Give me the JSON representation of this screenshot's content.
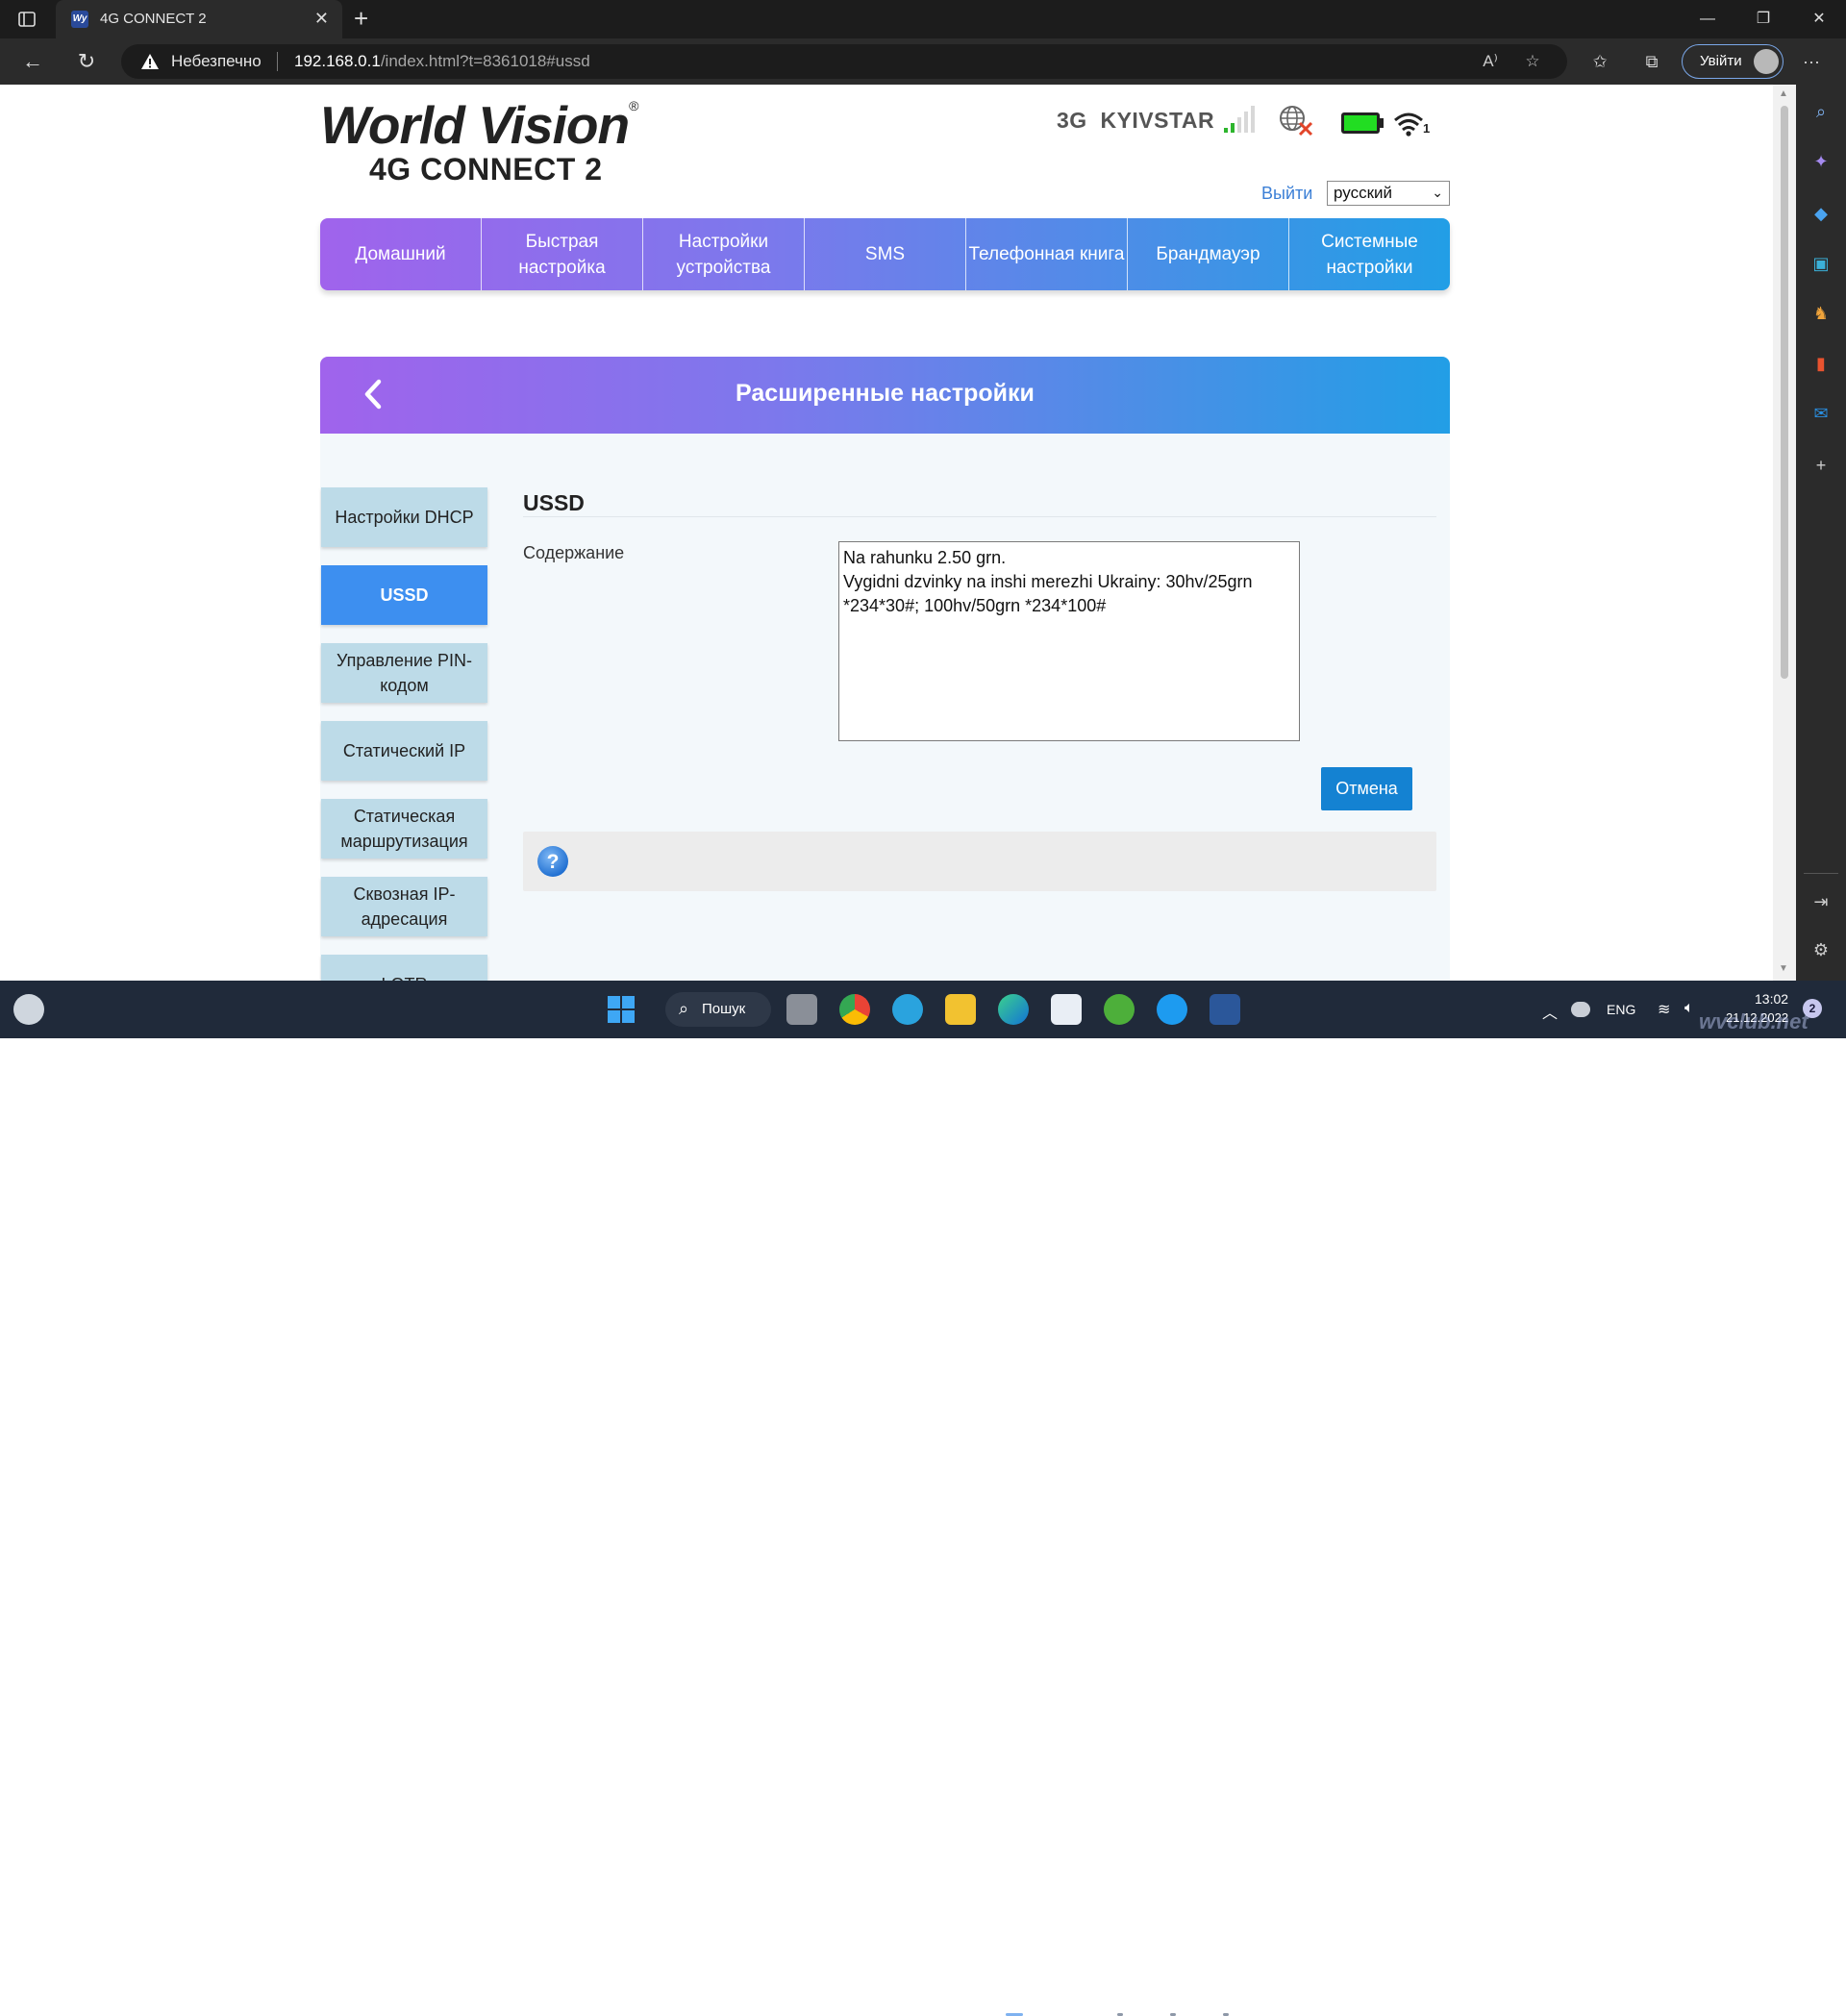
{
  "browser": {
    "tab_title": "4G CONNECT 2",
    "tab_favicon": "Wy",
    "security_label": "Небезпечно",
    "url_host": "192.168.0.1",
    "url_path": "/index.html?t=8361018#ussd",
    "signin_label": "Увійти"
  },
  "header": {
    "logo_brand": "World Vision",
    "logo_registered": "®",
    "logo_model": "4G CONNECT 2",
    "network_type": "3G",
    "operator": "KYIVSTAR",
    "wifi_clients": "1",
    "logout_label": "Выйти",
    "language_selected": "русский"
  },
  "main_nav": [
    {
      "label": "Домашний"
    },
    {
      "label": "Быстрая настройка"
    },
    {
      "label": "Настройки устройства"
    },
    {
      "label": "SMS"
    },
    {
      "label": "Телефонная книга"
    },
    {
      "label": "Брандмауэр"
    },
    {
      "label": "Системные настройки"
    }
  ],
  "panel": {
    "title": "Расширенные настройки"
  },
  "side_menu": [
    {
      "label": "Настройки DHCP",
      "active": false
    },
    {
      "label": "USSD",
      "active": true
    },
    {
      "label": "Управление PIN-кодом",
      "active": false
    },
    {
      "label": "Статический IP",
      "active": false
    },
    {
      "label": "Статическая маршрутизация",
      "active": false
    },
    {
      "label": "Сквозная IP-адресация",
      "active": false
    },
    {
      "label": "LOTR",
      "active": false
    }
  ],
  "ussd": {
    "section_title": "USSD",
    "content_label": "Содержание",
    "content_lines": [
      "Na rahunku 2.50 grn.",
      "Vygidni dzvinky na inshi merezhi Ukrainy: 30hv/25grn",
      "*234*30#; 100hv/50grn *234*100#"
    ],
    "cancel_label": "Отмена"
  },
  "taskbar": {
    "search_label": "Пошук",
    "language": "ENG",
    "time": "13:02",
    "date": "21.12.2022",
    "notifications": "2",
    "watermark": "wvclub.net"
  },
  "colors": {
    "nav_gradient_start": "#a063ec",
    "nav_gradient_end": "#229ee6",
    "active_side": "#3d8ff0",
    "side_button": "#bddbe8",
    "cancel_button": "#1482d2",
    "link": "#3b7fd6",
    "battery_fill": "#22dd22"
  }
}
